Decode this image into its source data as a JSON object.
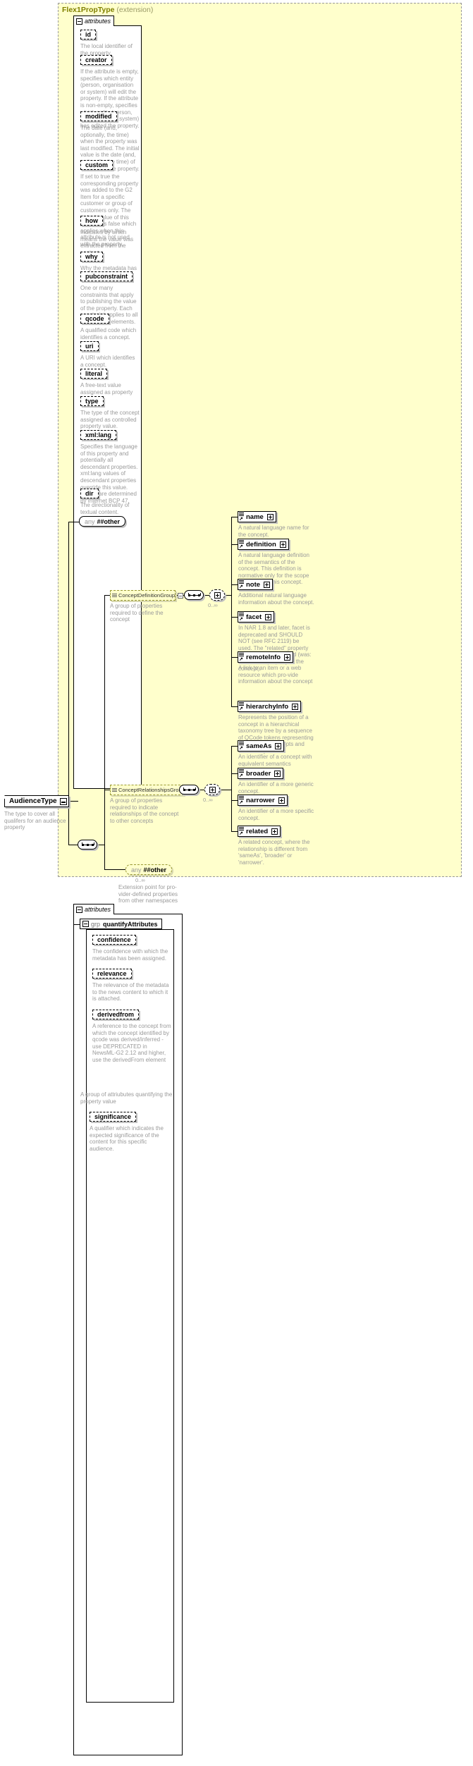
{
  "diagram": {
    "title": "Flex1PropType",
    "title_suffix": "(extension)",
    "attributes_tab_label": "attributes",
    "root": {
      "name": "AudienceType",
      "note": "The type to cover all qualifers for an audience property"
    },
    "any_other": {
      "keyword": "any",
      "name": "##other"
    }
  },
  "attributes": [
    {
      "name": "id",
      "note": "The local identifier of the property."
    },
    {
      "name": "creator",
      "note": "If the attribute is empty, specifies which entity (person, organisation or system) will edit the property. If the attribute is non-empty, specifies which entity (person, organisation or system) has edited the property."
    },
    {
      "name": "modified",
      "note": "The date (and, optionally, the time) when the property was last modified. The initial value is the date (and, optionally, the time) of creation of the property."
    },
    {
      "name": "custom",
      "note": "If set to true the corresponding property was added to the G2 Item for a specific customer or group of customers only. The default value of this property is false which applies when this attribute is not used with the property."
    },
    {
      "name": "how",
      "note": "Indicates by which means the value was extracted from the content."
    },
    {
      "name": "why",
      "note": "Why the metadata has been included."
    },
    {
      "name": "pubconstraint",
      "note": "One or many constraints that apply to publishing the value of the property. Each constraint applies to all descendant elements."
    },
    {
      "name": "qcode",
      "note": "A qualified code which identifies a concept."
    },
    {
      "name": "uri",
      "note": "A URI which identifies a concept."
    },
    {
      "name": "literal",
      "note": "A free-text value assigned as property value."
    },
    {
      "name": "type",
      "note": "The type of the concept assigned as controlled property value."
    },
    {
      "name": "xml:lang",
      "note": "Specifies the language of this property and potentially all descendant properties. xml:lang values of descendant properties override this value. Values are determined by Internet BCP 47."
    },
    {
      "name": "dir",
      "note": "The directionality of textual content."
    }
  ],
  "groups": [
    {
      "id": "concept-definition-group",
      "name": "ConceptDefinitionGroup",
      "note": "A group of properties required to define the concept",
      "occurrence": "0..∞",
      "elements": [
        {
          "name": "name",
          "note": "A natural language name for the concept."
        },
        {
          "name": "definition",
          "note": "A natural language definition of the semantics of the concept. This definition is normative only for the scope of the use of this concept."
        },
        {
          "name": "note",
          "note": "Additional natural language information about the concept."
        },
        {
          "name": "facet",
          "note": "In NAR 1.8 and later, facet is deprecated and SHOULD NOT (see RFC 2119) be used. The \"related\" property should be used instead (was: An intrinsic property of the concept)."
        },
        {
          "name": "remoteInfo",
          "note": "A link to an item or a web resource which pro-vide information about the concept"
        },
        {
          "name": "hierarchyInfo",
          "note": "Represents the position of a concept in a hierarchical taxonomy tree by a sequence of QCode tokens representing the ancestor concepts and this concept"
        }
      ]
    },
    {
      "id": "concept-relationships-group",
      "name": "ConceptRelationshipsGroup",
      "note": "A group of properties required to indicate relationships of the concept to other concepts",
      "occurrence": "0..∞",
      "elements": [
        {
          "name": "sameAs",
          "note": "An identifier of a concept with equivalent semantics"
        },
        {
          "name": "broader",
          "note": "An identifier of a more generic concept."
        },
        {
          "name": "narrower",
          "note": "An identifier of a more specific concept."
        },
        {
          "name": "related",
          "note": "A related concept, where the relationship is different from 'sameAs', 'broader' or 'narrower'."
        }
      ]
    }
  ],
  "any_extension": {
    "keyword": "any",
    "name": "##other",
    "occurrence": "0..∞",
    "note": "Extension point for pro-vider-defined properties from other namespaces"
  },
  "bottom": {
    "attributes_tab_label": "attributes",
    "group_keyword": "grp",
    "group_name": "quantifyAttributes",
    "group_note": "A group of attriubutes quantifying the property value",
    "attributes": [
      {
        "name": "confidence",
        "note": "The confidence with which the metadata has been assigned."
      },
      {
        "name": "relevance",
        "note": "The relevance of the metadata to the news content to which it is attached."
      },
      {
        "name": "derivedfrom",
        "note": "A reference to the concept from which the concept identified by qcode was derived/inferred - use DEPRECATED in NewsML-G2 2.12 and higher, use the derivedFrom element"
      }
    ],
    "trailing_attribute": {
      "name": "significance",
      "note": "A qualifier which indicates the expected significance of the content for this specific audience."
    }
  },
  "colors": {
    "panel_bg": "#ffffcc",
    "panel_border": "#999999",
    "title": "#808000",
    "note": "#9a9a9a",
    "shadow": "#c0c0c0"
  }
}
